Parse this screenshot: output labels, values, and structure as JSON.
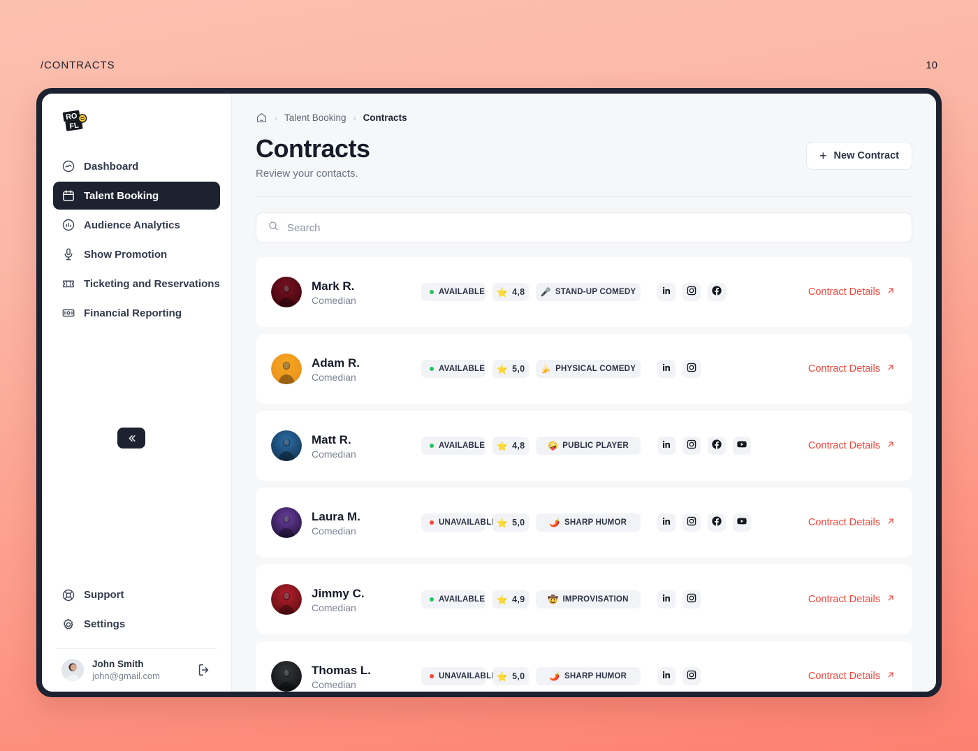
{
  "topbar": {
    "route": "/CONTRACTS",
    "page_number": "10"
  },
  "sidebar": {
    "logo_text_top": "RO",
    "logo_text_bottom": "FL",
    "items": [
      {
        "label": "Dashboard",
        "icon": "activity-circle-icon",
        "active": false
      },
      {
        "label": "Talent Booking",
        "icon": "calendar-icon",
        "active": true
      },
      {
        "label": "Audience Analytics",
        "icon": "chart-circle-icon",
        "active": false
      },
      {
        "label": "Show Promotion",
        "icon": "microphone-icon",
        "active": false
      },
      {
        "label": "Ticketing and Reservations",
        "icon": "ticket-icon",
        "active": false
      },
      {
        "label": "Financial Reporting",
        "icon": "banknote-icon",
        "active": false
      }
    ],
    "bottom_items": [
      {
        "label": "Support",
        "icon": "lifebuoy-icon"
      },
      {
        "label": "Settings",
        "icon": "gear-icon"
      }
    ],
    "user": {
      "name": "John Smith",
      "email": "john@gmail.com"
    },
    "collapse_label": "«"
  },
  "breadcrumb": {
    "home_icon": "home-icon",
    "items": [
      {
        "label": "Talent Booking",
        "current": false
      },
      {
        "label": "Contracts",
        "current": true
      }
    ],
    "separator": "›"
  },
  "header": {
    "title": "Contracts",
    "subtitle": "Review your contacts.",
    "new_contract_label": "New Contract",
    "new_contract_plus": "+"
  },
  "search": {
    "placeholder": "Search",
    "value": ""
  },
  "colors": {
    "accent_red": "#f4463c",
    "available_green": "#22c55e",
    "unavailable_red": "#f4463c",
    "dark": "#1d2230",
    "badge_bg": "#f2f3f6"
  },
  "contacts": [
    {
      "name": "Mark R.",
      "role": "Comedian",
      "status": "AVAILABLE",
      "status_available": true,
      "rating": "4,8",
      "genre": "STAND-UP COMEDY",
      "genre_emoji": "🎤",
      "socials": [
        "linkedin-icon",
        "instagram-icon",
        "facebook-icon"
      ],
      "details_label": "Contract Details",
      "avatar_colors": [
        "#7b1020",
        "#3a060e"
      ]
    },
    {
      "name": "Adam R.",
      "role": "Comedian",
      "status": "AVAILABLE",
      "status_available": true,
      "rating": "5,0",
      "genre": "PHYSICAL COMEDY",
      "genre_emoji": "🍌",
      "socials": [
        "linkedin-icon",
        "instagram-icon"
      ],
      "details_label": "Contract Details",
      "avatar_colors": [
        "#f5a623",
        "#e8901a"
      ]
    },
    {
      "name": "Matt R.",
      "role": "Comedian",
      "status": "AVAILABLE",
      "status_available": true,
      "rating": "4,8",
      "genre": "PUBLIC PLAYER",
      "genre_emoji": "🤪",
      "socials": [
        "linkedin-icon",
        "instagram-icon",
        "facebook-icon",
        "youtube-icon"
      ],
      "details_label": "Contract Details",
      "avatar_colors": [
        "#2b6ea8",
        "#13324f"
      ]
    },
    {
      "name": "Laura M.",
      "role": "Comedian",
      "status": "UNAVAILABLE",
      "status_available": false,
      "rating": "5,0",
      "genre": "SHARP HUMOR",
      "genre_emoji": "🌶️",
      "socials": [
        "linkedin-icon",
        "instagram-icon",
        "facebook-icon",
        "youtube-icon"
      ],
      "details_label": "Contract Details",
      "avatar_colors": [
        "#6b3fa0",
        "#20113a"
      ]
    },
    {
      "name": "Jimmy C.",
      "role": "Comedian",
      "status": "AVAILABLE",
      "status_available": true,
      "rating": "4,9",
      "genre": "IMPROVISATION",
      "genre_emoji": "🤠",
      "socials": [
        "linkedin-icon",
        "instagram-icon"
      ],
      "details_label": "Contract Details",
      "avatar_colors": [
        "#b3202b",
        "#5d0d14"
      ]
    },
    {
      "name": "Thomas L.",
      "role": "Comedian",
      "status": "UNAVAILABLE",
      "status_available": false,
      "rating": "5,0",
      "genre": "SHARP HUMOR",
      "genre_emoji": "🌶️",
      "socials": [
        "linkedin-icon",
        "instagram-icon"
      ],
      "details_label": "Contract Details",
      "avatar_colors": [
        "#35383c",
        "#0c0d0f"
      ]
    }
  ]
}
